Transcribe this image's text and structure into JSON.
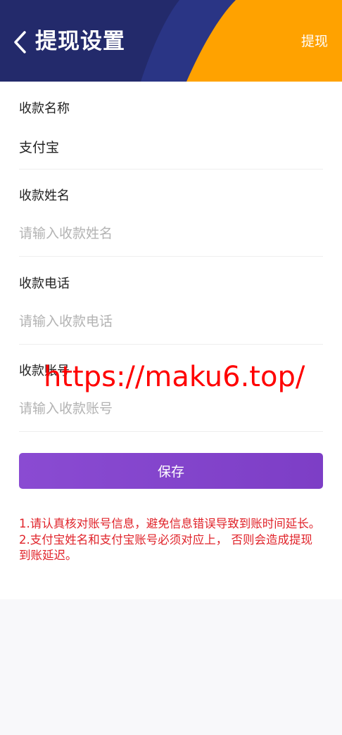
{
  "header": {
    "title": "提现设置",
    "action_label": "提现",
    "colors": {
      "navy": "#232a6b",
      "blue_band": "#2a3585",
      "orange": "#ffa200"
    }
  },
  "form": {
    "fields": [
      {
        "label": "收款名称",
        "value": "支付宝",
        "placeholder": ""
      },
      {
        "label": "收款姓名",
        "value": "",
        "placeholder": "请输入收款姓名"
      },
      {
        "label": "收款电话",
        "value": "",
        "placeholder": "请输入收款电话"
      },
      {
        "label": "收款账号",
        "value": "",
        "placeholder": "请输入收款账号"
      }
    ],
    "save_label": "保存"
  },
  "notice": {
    "line1": "1.请认真核对账号信息，避免信息错误导致到账时间延长。",
    "line2": "2.支付宝姓名和支付宝账号必须对应上， 否则会造成提现到账延迟。"
  },
  "watermark": "https://maku6.top/"
}
